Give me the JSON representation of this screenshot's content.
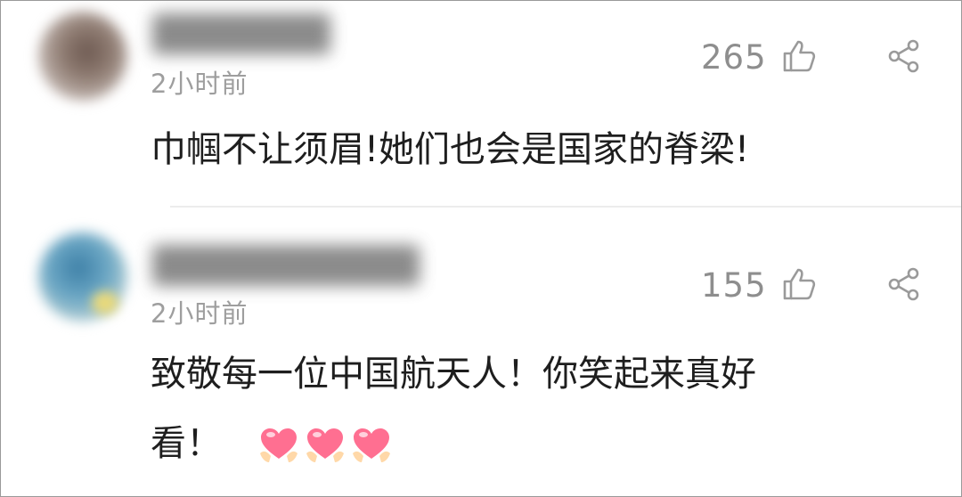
{
  "comments": [
    {
      "time": "2小时前",
      "likes": "265",
      "text": "巾帼不让须眉!她们也会是国家的脊梁!"
    },
    {
      "time": "2小时前",
      "likes": "155",
      "text_line1": "致敬每一位中国航天人！你笑起来真好",
      "text_line2": "看！",
      "emojis": [
        "heart-hands",
        "heart-hands",
        "heart-hands"
      ]
    }
  ],
  "icons": {
    "like": "thumbs-up-icon",
    "share": "share-icon"
  },
  "colors": {
    "meta": "#9e9e9e",
    "text": "#1e1e1e",
    "heart": "#ff6f91"
  }
}
